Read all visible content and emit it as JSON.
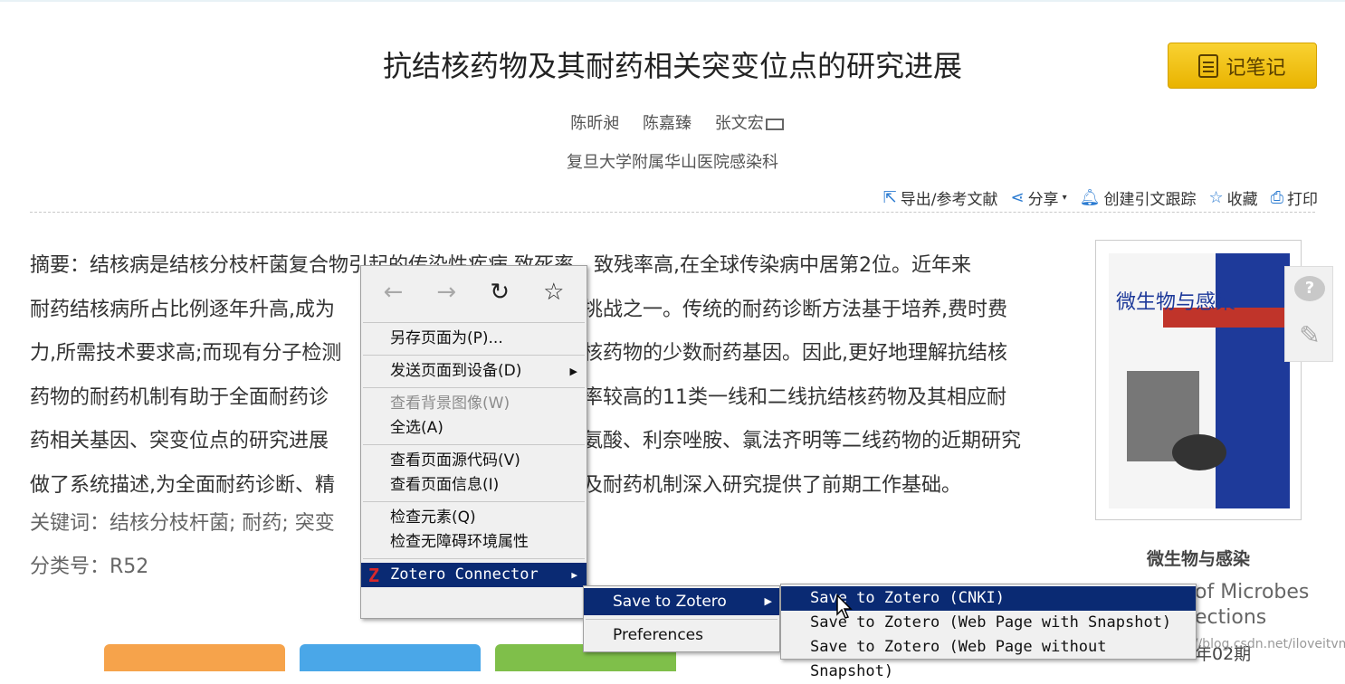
{
  "article": {
    "title": "抗结核药物及其耐药相关突变位点的研究进展",
    "note_button": "记笔记",
    "authors": [
      "陈昕昶",
      "陈嘉臻",
      "张文宏"
    ],
    "affiliation": "复旦大学附属华山医院感染科",
    "toolbar": {
      "export": "导出/参考文献",
      "share": "分享",
      "track": "创建引文跟踪",
      "favorite": "收藏",
      "print": "打印"
    },
    "abstract_lines": [
      "摘要：结核病是结核分枝杆菌复合物引起的传染性疾病,致死率、致残率高,在全球传染病中居第2位。近年来",
      "耐药结核病所占比例逐年升高,成为",
      "力,所需技术要求高;而现有分子检测",
      "药物的耐药机制有助于全面耐药诊",
      "药相关基因、突变位点的研究进展",
      "做了系统描述,为全面耐药诊断、精"
    ],
    "abstract_right_fragments": [
      "挑战之一。传统的耐药诊断方法基于培养,费时费",
      "核药物的少数耐药基因。因此,更好地理解抗结核",
      "频率较高的11类一线和二线抗结核药物及其相应耐",
      "氨酸、利奈唑胺、氯法齐明等二线药物的近期研究",
      "及耐药机制深入研究提供了前期工作基础。"
    ],
    "keywords": "关键词：结核分枝杆菌; 耐药; 突变",
    "classification": "分类号：R52",
    "journal_cn": "微生物与感染",
    "journal_en_line1": "of Microbes",
    "journal_en_line2": "ections",
    "issue": "年02期",
    "cover_title": "微生物与感染"
  },
  "context_menu": {
    "items": [
      {
        "label": "另存页面为(P)..."
      },
      {
        "label": "发送页面到设备(D)"
      },
      {
        "label": "查看背景图像(W)"
      },
      {
        "label": "全选(A)"
      },
      {
        "label": "查看页面源代码(V)"
      },
      {
        "label": "查看页面信息(I)"
      },
      {
        "label": "检查元素(Q)"
      },
      {
        "label": "检查无障碍环境属性"
      },
      {
        "label": "Zotero Connector"
      }
    ]
  },
  "submenu": {
    "save": "Save to Zotero",
    "preferences": "Preferences"
  },
  "zotero_options": [
    "Save to Zotero (CNKI)",
    "Save to Zotero (Web Page with Snapshot)",
    "Save to Zotero (Web Page without Snapshot)"
  ],
  "watermark": "https://blog.csdn.net/iloveitvm",
  "colors": {
    "menu_highlight": "#0a2a73",
    "note_button": "#f2c100",
    "accent_blue": "#2b7bd1"
  }
}
